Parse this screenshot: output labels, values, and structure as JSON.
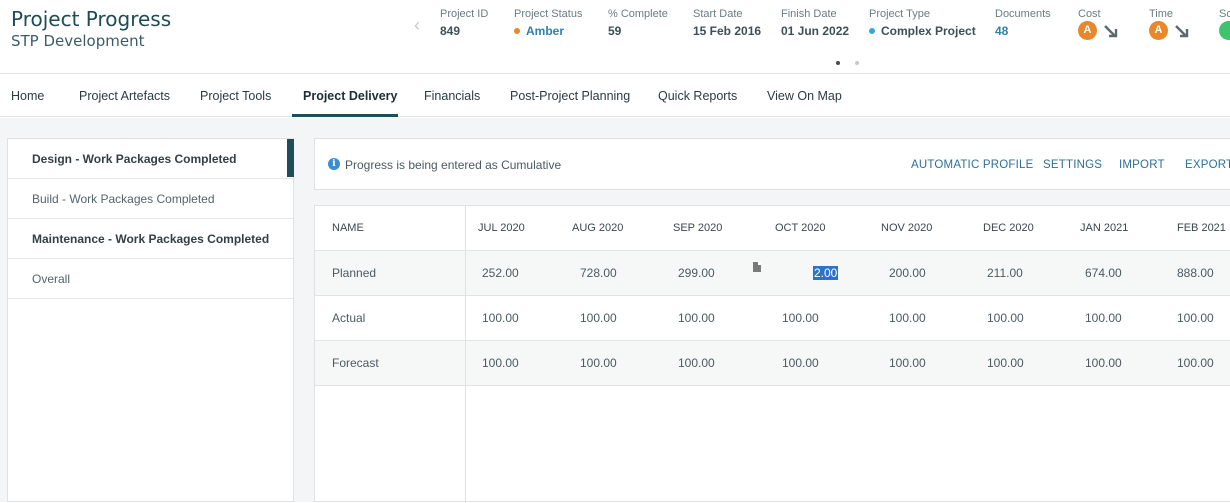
{
  "header": {
    "title": "Project Progress",
    "subtitle": "STP Development",
    "fields": [
      {
        "label": "Project ID",
        "value": "849"
      },
      {
        "label": "Project Status",
        "value": "Amber",
        "dot_color": "#e8872b"
      },
      {
        "label": "% Complete",
        "value": "59"
      },
      {
        "label": "Start Date",
        "value": "15 Feb 2016"
      },
      {
        "label": "Finish Date",
        "value": "01 Jun 2022"
      },
      {
        "label": "Project Type",
        "value": "Complex Project",
        "dot_color": "#3aa3e0"
      },
      {
        "label": "Documents",
        "value": "48"
      }
    ],
    "cost": {
      "label": "Cost",
      "badge": "A",
      "color": "#e8872b"
    },
    "time": {
      "label": "Time",
      "badge": "A",
      "color": "#e8872b"
    },
    "scope": {
      "label": "Sc",
      "color": "#3ec46d"
    }
  },
  "tabs": [
    {
      "label": "Home"
    },
    {
      "label": "Project Artefacts"
    },
    {
      "label": "Project Tools"
    },
    {
      "label": "Project Delivery",
      "active": true
    },
    {
      "label": "Financials"
    },
    {
      "label": "Post-Project Planning"
    },
    {
      "label": "Quick Reports"
    },
    {
      "label": "View On Map"
    }
  ],
  "sidebar": {
    "items": [
      {
        "label": "Design - Work Packages Completed"
      },
      {
        "label": "Build - Work Packages Completed"
      },
      {
        "label": "Maintenance - Work Packages Completed"
      },
      {
        "label": "Overall"
      }
    ]
  },
  "infobar": {
    "text": "Progress is being entered as Cumulative",
    "actions": [
      "AUTOMATIC PROFILE",
      "SETTINGS",
      "IMPORT",
      "EXPORT"
    ]
  },
  "grid": {
    "name_header": "NAME",
    "months": [
      "JUL 2020",
      "AUG 2020",
      "SEP 2020",
      "OCT 2020",
      "NOV 2020",
      "DEC 2020",
      "JAN 2021",
      "FEB 2021"
    ],
    "rows": [
      {
        "name": "Planned",
        "values": [
          "252.00",
          "728.00",
          "299.00",
          "2.00",
          "200.00",
          "211.00",
          "674.00",
          "888.00"
        ]
      },
      {
        "name": "Actual",
        "values": [
          "100.00",
          "100.00",
          "100.00",
          "100.00",
          "100.00",
          "100.00",
          "100.00",
          "100.00"
        ]
      },
      {
        "name": "Forecast",
        "values": [
          "100.00",
          "100.00",
          "100.00",
          "100.00",
          "100.00",
          "100.00",
          "100.00",
          "100.00"
        ]
      }
    ]
  }
}
